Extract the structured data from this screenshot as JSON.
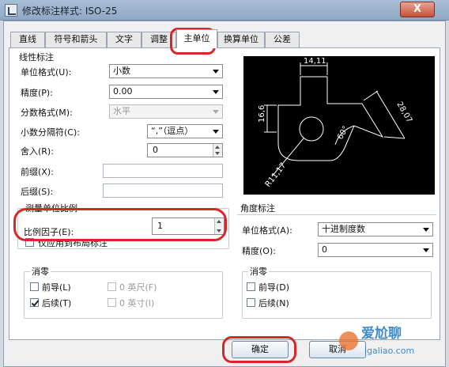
{
  "window": {
    "title": "修改标注样式: ISO-25",
    "close_glyph": "X"
  },
  "tabs": [
    {
      "label": "直线"
    },
    {
      "label": "符号和箭头"
    },
    {
      "label": "文字"
    },
    {
      "label": "调整"
    },
    {
      "label": "主单位"
    },
    {
      "label": "换算单位"
    },
    {
      "label": "公差"
    }
  ],
  "linear": {
    "title": "线性标注",
    "unit_format": {
      "label": "单位格式(U):",
      "value": "小数"
    },
    "precision": {
      "label": "精度(P):",
      "value": "0.00"
    },
    "fraction_format": {
      "label": "分数格式(M):",
      "value": "水平"
    },
    "decimal_separator": {
      "label": "小数分隔符(C):",
      "value": "“,”（逗点）"
    },
    "round_off": {
      "label": "舍入(R):",
      "value": "0"
    },
    "prefix": {
      "label": "前缀(X):",
      "value": ""
    },
    "suffix": {
      "label": "后缀(S):",
      "value": ""
    }
  },
  "measurement_scale": {
    "title": "测量单位比例",
    "scale_factor": {
      "label": "比例因子(E):",
      "value": "1"
    },
    "layout_only": {
      "label": "仅应用到布局标注"
    }
  },
  "zero_suppression_linear": {
    "title": "消零",
    "leading": {
      "label": "前导(L)",
      "checked": false
    },
    "trailing": {
      "label": "后续(T)",
      "checked": true
    },
    "feet": {
      "label": "0 英尺(F)",
      "checked": false
    },
    "inches": {
      "label": "0 英寸(I)",
      "checked": false
    }
  },
  "angular": {
    "title": "角度标注",
    "unit_format": {
      "label": "单位格式(A):",
      "value": "十进制度数"
    },
    "precision": {
      "label": "精度(O):",
      "value": "0"
    }
  },
  "zero_suppression_angular": {
    "title": "消零",
    "leading": {
      "label": "前导(D)",
      "checked": false
    },
    "trailing": {
      "label": "后续(N)",
      "checked": false
    }
  },
  "preview": {
    "dim_top": "14,11",
    "dim_left": "16,6",
    "dim_right": "28,07",
    "dim_angle": "60°",
    "dim_radius": "R11,17"
  },
  "buttons": {
    "ok": "确定",
    "cancel": "取消"
  },
  "watermark": {
    "line1": "爱尬聊",
    "line2": "igaliao.com"
  }
}
